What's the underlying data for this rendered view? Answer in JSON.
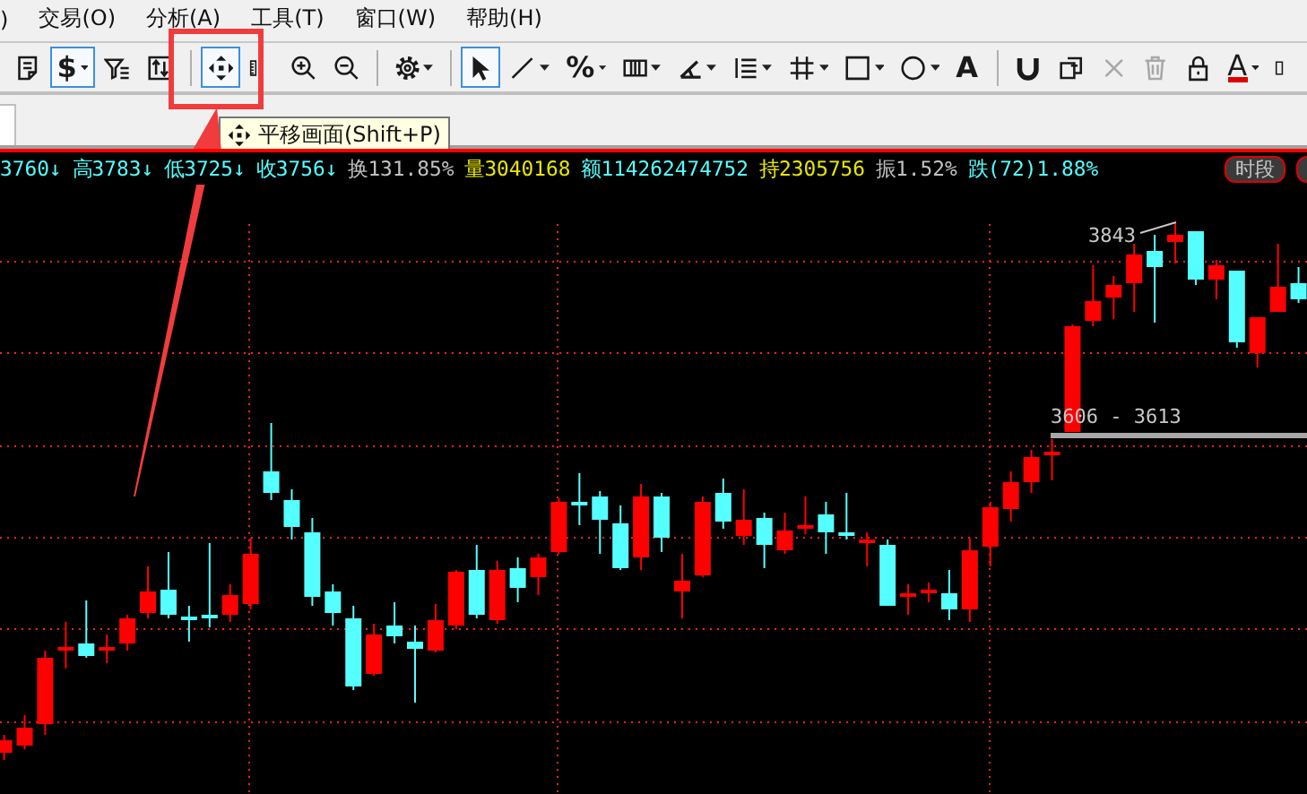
{
  "menu_bar": {
    "items": [
      ")",
      "交易(O)",
      "分析(A)",
      "工具(T)",
      "窗口(W)",
      "帮助(H)"
    ]
  },
  "toolbar": {
    "groups": [
      [
        {
          "kind": "icon",
          "selected": false,
          "dropdown": false,
          "disabled": false
        },
        {
          "kind": "text",
          "label": "$",
          "selected": true,
          "dropdown": true,
          "disabled": false
        },
        {
          "kind": "icon",
          "selected": false,
          "dropdown": false,
          "disabled": false
        },
        {
          "kind": "icon",
          "selected": false,
          "dropdown": false,
          "disabled": false
        }
      ],
      [
        {
          "kind": "icon",
          "selected": true,
          "dropdown": false,
          "disabled": false
        },
        {
          "kind": "icon",
          "selected": false,
          "dropdown": false,
          "disabled": false
        },
        {
          "kind": "icon",
          "selected": false,
          "dropdown": false,
          "disabled": false
        },
        {
          "kind": "icon",
          "selected": false,
          "dropdown": false,
          "disabled": false
        }
      ],
      [
        {
          "kind": "icon",
          "selected": false,
          "dropdown": true,
          "disabled": false
        }
      ],
      [
        {
          "kind": "icon",
          "selected": true,
          "dropdown": false,
          "disabled": false
        },
        {
          "kind": "icon",
          "selected": false,
          "dropdown": true,
          "disabled": false
        },
        {
          "kind": "text",
          "label": "%",
          "selected": false,
          "dropdown": true,
          "disabled": false
        },
        {
          "kind": "icon",
          "selected": false,
          "dropdown": true,
          "disabled": false
        },
        {
          "kind": "icon",
          "selected": false,
          "dropdown": true,
          "disabled": false
        },
        {
          "kind": "icon",
          "selected": false,
          "dropdown": true,
          "disabled": false
        },
        {
          "kind": "icon",
          "selected": false,
          "dropdown": true,
          "disabled": false
        },
        {
          "kind": "icon",
          "selected": false,
          "dropdown": true,
          "disabled": false
        },
        {
          "kind": "icon",
          "selected": false,
          "dropdown": true,
          "disabled": false
        },
        {
          "kind": "text",
          "label": "A",
          "selected": false,
          "dropdown": false,
          "disabled": false
        }
      ],
      [
        {
          "kind": "icon",
          "selected": false,
          "dropdown": false,
          "disabled": false
        },
        {
          "kind": "icon",
          "selected": false,
          "dropdown": false,
          "disabled": false
        },
        {
          "kind": "icon",
          "selected": false,
          "dropdown": false,
          "disabled": true
        },
        {
          "kind": "icon",
          "selected": false,
          "dropdown": false,
          "disabled": true
        },
        {
          "kind": "icon",
          "selected": false,
          "dropdown": false,
          "disabled": false
        },
        {
          "kind": "font-color",
          "label": "A",
          "selected": false,
          "dropdown": true,
          "disabled": false
        },
        {
          "kind": "icon",
          "selected": false,
          "dropdown": false,
          "disabled": false
        }
      ]
    ]
  },
  "tooltip": {
    "text": "平移画面(Shift+P)"
  },
  "quote_bar": {
    "items": [
      {
        "text": "3760↓",
        "color": "#55ffff"
      },
      {
        "text": "高3783↓",
        "color": "#55ffff"
      },
      {
        "text": "低3725↓",
        "color": "#55ffff"
      },
      {
        "text": "收3756↓",
        "color": "#55ffff"
      },
      {
        "text": "换131.85%",
        "color": "#c0c0c0"
      },
      {
        "text": "量3040168",
        "color": "#e6e600"
      },
      {
        "text": "额114262474752",
        "color": "#55ffff"
      },
      {
        "text": "持2305756",
        "color": "#e6e600"
      },
      {
        "text": "振1.52%",
        "color": "#c0c0c0"
      },
      {
        "text": "跌(72)1.88%",
        "color": "#55ffff"
      }
    ],
    "period_button": "时段"
  },
  "chart": {
    "high_label": "3843",
    "range_label": "3606 - 3613"
  }
}
